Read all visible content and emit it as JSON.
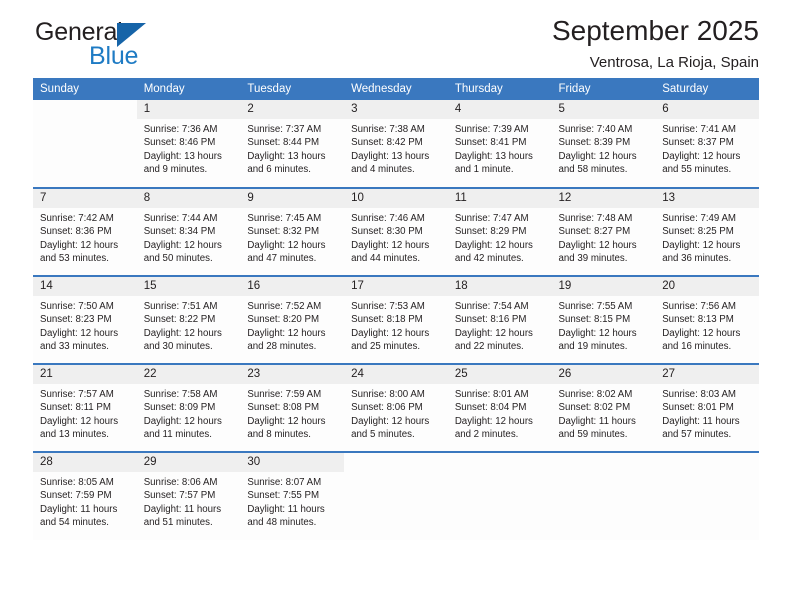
{
  "brand": {
    "name_top": "General",
    "name_bottom": "Blue",
    "triangle_color": "#1664a8",
    "blue_color": "#1e7bc4"
  },
  "header": {
    "title": "September 2025",
    "subtitle": "Ventrosa, La Rioja, Spain"
  },
  "theme": {
    "header_blue": "#3a78bf",
    "daynum_band": "#efefef",
    "cell_background": "#fdfdfd",
    "text": "#231f20"
  },
  "calendar": {
    "weekday_headers": [
      "Sunday",
      "Monday",
      "Tuesday",
      "Wednesday",
      "Thursday",
      "Friday",
      "Saturday"
    ],
    "weeks": [
      [
        {
          "day": "",
          "sunrise": "",
          "sunset": "",
          "daylight": "",
          "empty": true
        },
        {
          "day": "1",
          "sunrise": "Sunrise: 7:36 AM",
          "sunset": "Sunset: 8:46 PM",
          "daylight": "Daylight: 13 hours and 9 minutes."
        },
        {
          "day": "2",
          "sunrise": "Sunrise: 7:37 AM",
          "sunset": "Sunset: 8:44 PM",
          "daylight": "Daylight: 13 hours and 6 minutes."
        },
        {
          "day": "3",
          "sunrise": "Sunrise: 7:38 AM",
          "sunset": "Sunset: 8:42 PM",
          "daylight": "Daylight: 13 hours and 4 minutes."
        },
        {
          "day": "4",
          "sunrise": "Sunrise: 7:39 AM",
          "sunset": "Sunset: 8:41 PM",
          "daylight": "Daylight: 13 hours and 1 minute."
        },
        {
          "day": "5",
          "sunrise": "Sunrise: 7:40 AM",
          "sunset": "Sunset: 8:39 PM",
          "daylight": "Daylight: 12 hours and 58 minutes."
        },
        {
          "day": "6",
          "sunrise": "Sunrise: 7:41 AM",
          "sunset": "Sunset: 8:37 PM",
          "daylight": "Daylight: 12 hours and 55 minutes."
        }
      ],
      [
        {
          "day": "7",
          "sunrise": "Sunrise: 7:42 AM",
          "sunset": "Sunset: 8:36 PM",
          "daylight": "Daylight: 12 hours and 53 minutes."
        },
        {
          "day": "8",
          "sunrise": "Sunrise: 7:44 AM",
          "sunset": "Sunset: 8:34 PM",
          "daylight": "Daylight: 12 hours and 50 minutes."
        },
        {
          "day": "9",
          "sunrise": "Sunrise: 7:45 AM",
          "sunset": "Sunset: 8:32 PM",
          "daylight": "Daylight: 12 hours and 47 minutes."
        },
        {
          "day": "10",
          "sunrise": "Sunrise: 7:46 AM",
          "sunset": "Sunset: 8:30 PM",
          "daylight": "Daylight: 12 hours and 44 minutes."
        },
        {
          "day": "11",
          "sunrise": "Sunrise: 7:47 AM",
          "sunset": "Sunset: 8:29 PM",
          "daylight": "Daylight: 12 hours and 42 minutes."
        },
        {
          "day": "12",
          "sunrise": "Sunrise: 7:48 AM",
          "sunset": "Sunset: 8:27 PM",
          "daylight": "Daylight: 12 hours and 39 minutes."
        },
        {
          "day": "13",
          "sunrise": "Sunrise: 7:49 AM",
          "sunset": "Sunset: 8:25 PM",
          "daylight": "Daylight: 12 hours and 36 minutes."
        }
      ],
      [
        {
          "day": "14",
          "sunrise": "Sunrise: 7:50 AM",
          "sunset": "Sunset: 8:23 PM",
          "daylight": "Daylight: 12 hours and 33 minutes."
        },
        {
          "day": "15",
          "sunrise": "Sunrise: 7:51 AM",
          "sunset": "Sunset: 8:22 PM",
          "daylight": "Daylight: 12 hours and 30 minutes."
        },
        {
          "day": "16",
          "sunrise": "Sunrise: 7:52 AM",
          "sunset": "Sunset: 8:20 PM",
          "daylight": "Daylight: 12 hours and 28 minutes."
        },
        {
          "day": "17",
          "sunrise": "Sunrise: 7:53 AM",
          "sunset": "Sunset: 8:18 PM",
          "daylight": "Daylight: 12 hours and 25 minutes."
        },
        {
          "day": "18",
          "sunrise": "Sunrise: 7:54 AM",
          "sunset": "Sunset: 8:16 PM",
          "daylight": "Daylight: 12 hours and 22 minutes."
        },
        {
          "day": "19",
          "sunrise": "Sunrise: 7:55 AM",
          "sunset": "Sunset: 8:15 PM",
          "daylight": "Daylight: 12 hours and 19 minutes."
        },
        {
          "day": "20",
          "sunrise": "Sunrise: 7:56 AM",
          "sunset": "Sunset: 8:13 PM",
          "daylight": "Daylight: 12 hours and 16 minutes."
        }
      ],
      [
        {
          "day": "21",
          "sunrise": "Sunrise: 7:57 AM",
          "sunset": "Sunset: 8:11 PM",
          "daylight": "Daylight: 12 hours and 13 minutes."
        },
        {
          "day": "22",
          "sunrise": "Sunrise: 7:58 AM",
          "sunset": "Sunset: 8:09 PM",
          "daylight": "Daylight: 12 hours and 11 minutes."
        },
        {
          "day": "23",
          "sunrise": "Sunrise: 7:59 AM",
          "sunset": "Sunset: 8:08 PM",
          "daylight": "Daylight: 12 hours and 8 minutes."
        },
        {
          "day": "24",
          "sunrise": "Sunrise: 8:00 AM",
          "sunset": "Sunset: 8:06 PM",
          "daylight": "Daylight: 12 hours and 5 minutes."
        },
        {
          "day": "25",
          "sunrise": "Sunrise: 8:01 AM",
          "sunset": "Sunset: 8:04 PM",
          "daylight": "Daylight: 12 hours and 2 minutes."
        },
        {
          "day": "26",
          "sunrise": "Sunrise: 8:02 AM",
          "sunset": "Sunset: 8:02 PM",
          "daylight": "Daylight: 11 hours and 59 minutes."
        },
        {
          "day": "27",
          "sunrise": "Sunrise: 8:03 AM",
          "sunset": "Sunset: 8:01 PM",
          "daylight": "Daylight: 11 hours and 57 minutes."
        }
      ],
      [
        {
          "day": "28",
          "sunrise": "Sunrise: 8:05 AM",
          "sunset": "Sunset: 7:59 PM",
          "daylight": "Daylight: 11 hours and 54 minutes."
        },
        {
          "day": "29",
          "sunrise": "Sunrise: 8:06 AM",
          "sunset": "Sunset: 7:57 PM",
          "daylight": "Daylight: 11 hours and 51 minutes."
        },
        {
          "day": "30",
          "sunrise": "Sunrise: 8:07 AM",
          "sunset": "Sunset: 7:55 PM",
          "daylight": "Daylight: 11 hours and 48 minutes."
        },
        {
          "day": "",
          "sunrise": "",
          "sunset": "",
          "daylight": "",
          "empty": true
        },
        {
          "day": "",
          "sunrise": "",
          "sunset": "",
          "daylight": "",
          "empty": true
        },
        {
          "day": "",
          "sunrise": "",
          "sunset": "",
          "daylight": "",
          "empty": true
        },
        {
          "day": "",
          "sunrise": "",
          "sunset": "",
          "daylight": "",
          "empty": true
        }
      ]
    ]
  }
}
